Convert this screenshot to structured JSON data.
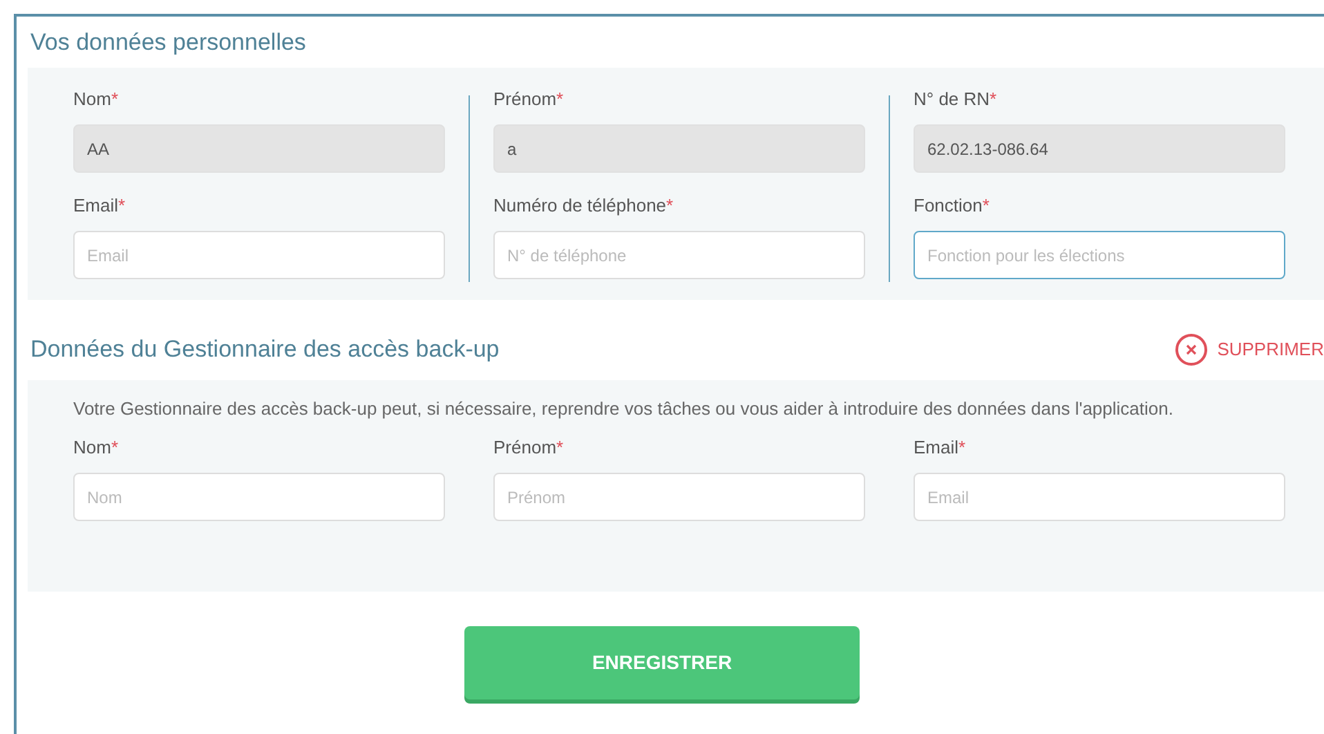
{
  "personal": {
    "title": "Vos données personnelles",
    "columns": [
      {
        "fields": [
          {
            "label": "Nom",
            "required_mark": "*",
            "value": "AA",
            "disabled": true
          },
          {
            "label": "Email",
            "required_mark": "*",
            "placeholder": "Email",
            "disabled": false,
            "focused": false
          }
        ]
      },
      {
        "fields": [
          {
            "label": "Prénom",
            "required_mark": "*",
            "value": "a",
            "disabled": true
          },
          {
            "label": "Numéro de téléphone",
            "required_mark": "*",
            "placeholder": "N° de téléphone",
            "disabled": false,
            "focused": false
          }
        ]
      },
      {
        "fields": [
          {
            "label": "N° de RN",
            "required_mark": "*",
            "value": "62.02.13-086.64",
            "disabled": true
          },
          {
            "label": "Fonction",
            "required_mark": "*",
            "placeholder": "Fonction pour les élections",
            "disabled": false,
            "focused": true
          }
        ]
      }
    ]
  },
  "backup": {
    "title": "Données du Gestionnaire des accès back-up",
    "delete_button": "SUPPRIMER",
    "description": "Votre Gestionnaire des accès back-up peut, si nécessaire, reprendre vos tâches ou vous aider à introduire des données dans l'application.",
    "fields": [
      {
        "label": "Nom",
        "required_mark": "*",
        "placeholder": "Nom",
        "disabled": false,
        "focused": false
      },
      {
        "label": "Prénom",
        "required_mark": "*",
        "placeholder": "Prénom",
        "disabled": false,
        "focused": false
      },
      {
        "label": "Email",
        "required_mark": "*",
        "placeholder": "Email",
        "disabled": false,
        "focused": false
      }
    ]
  },
  "save_button": "ENREGISTRER"
}
